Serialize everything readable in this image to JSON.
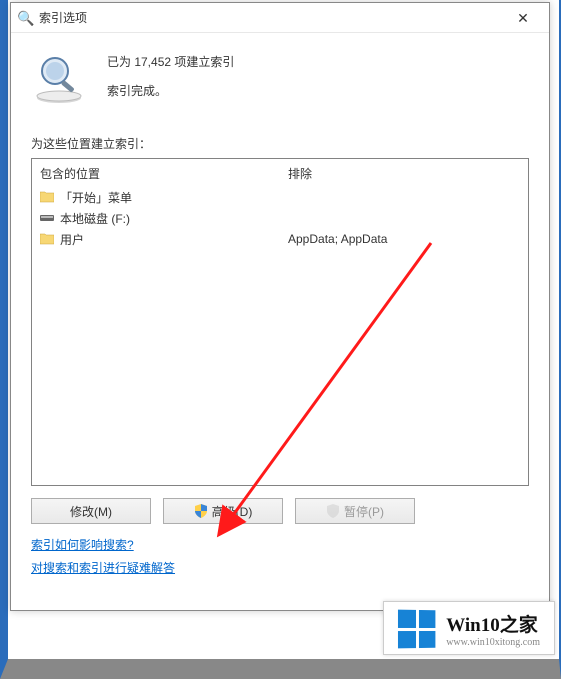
{
  "window": {
    "title": "索引选项",
    "close": "✕"
  },
  "status": {
    "indexed": "已为 17,452 项建立索引",
    "complete": "索引完成。"
  },
  "locations_label": "为这些位置建立索引：",
  "columns": {
    "included": "包含的位置",
    "excluded": "排除"
  },
  "included_items": [
    {
      "icon": "folder",
      "label": "「开始」菜单"
    },
    {
      "icon": "disk",
      "label": "本地磁盘 (F:)"
    },
    {
      "icon": "folder",
      "label": "用户"
    }
  ],
  "excluded_items": [
    {
      "label": ""
    },
    {
      "label": ""
    },
    {
      "label": "AppData; AppData"
    }
  ],
  "buttons": {
    "modify": "修改(M)",
    "advanced": "高级(D)",
    "pause": "暂停(P)"
  },
  "links": {
    "how_affect": "索引如何影响搜索?",
    "troubleshoot": "对搜索和索引进行疑难解答"
  },
  "watermark": {
    "brand": "Win10之家",
    "url": "www.win10xitong.com"
  }
}
